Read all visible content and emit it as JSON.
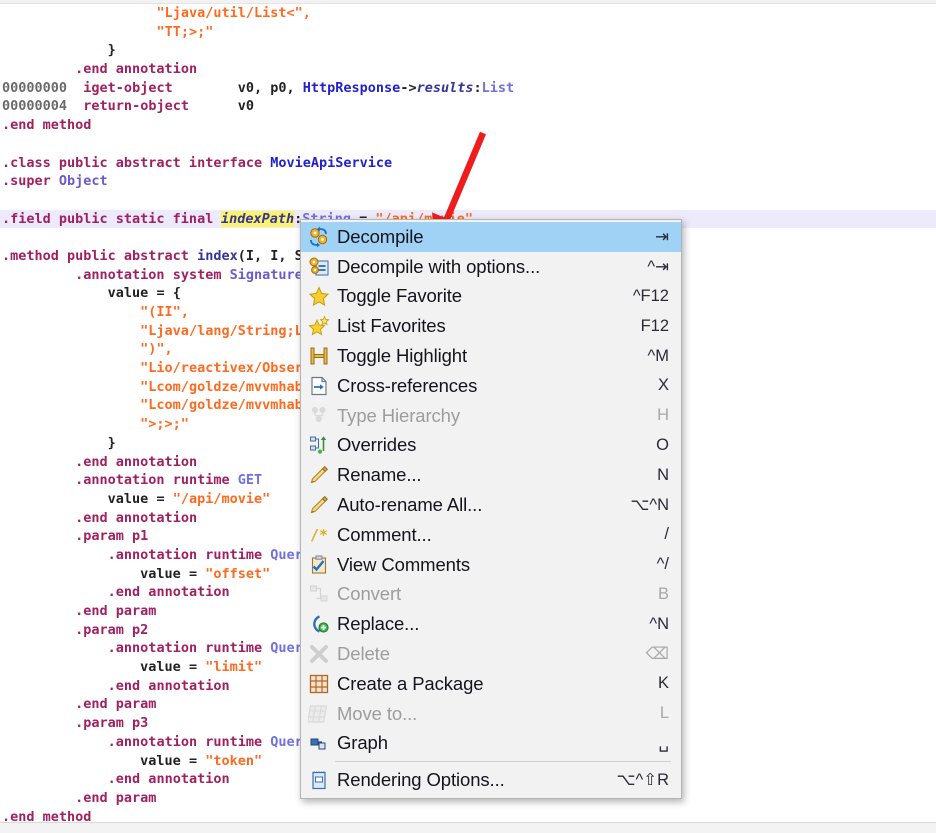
{
  "editor": {
    "name": "smali-code-view",
    "lines": [
      {
        "indent": 19,
        "tokens": [
          {
            "t": "\"Ljava/util/List<\",",
            "c": "t-str"
          }
        ]
      },
      {
        "indent": 19,
        "tokens": [
          {
            "t": "\"TT;>;\"",
            "c": "t-str"
          }
        ]
      },
      {
        "indent": 13,
        "tokens": [
          {
            "t": "}",
            "c": "t-plain"
          }
        ]
      },
      {
        "indent": 9,
        "tokens": [
          {
            "t": ".end annotation",
            "c": "t-dir"
          }
        ]
      },
      {
        "indent": 0,
        "tokens": [
          {
            "t": "00000000",
            "c": "t-num"
          },
          {
            "t": "  ",
            "c": "t-plain"
          },
          {
            "t": "iget-object",
            "c": "t-dir"
          },
          {
            "t": "        ",
            "c": "t-plain"
          },
          {
            "t": "v0, p0, ",
            "c": "t-plain"
          },
          {
            "t": "HttpResponse",
            "c": "t-blue"
          },
          {
            "t": "->",
            "c": "t-plain"
          },
          {
            "t": "results",
            "c": "t-field"
          },
          {
            "t": ":",
            "c": "t-plain"
          },
          {
            "t": "List",
            "c": "t-type"
          }
        ]
      },
      {
        "indent": 0,
        "tokens": [
          {
            "t": "00000004",
            "c": "t-num"
          },
          {
            "t": "  ",
            "c": "t-plain"
          },
          {
            "t": "return-object",
            "c": "t-dir"
          },
          {
            "t": "      ",
            "c": "t-plain"
          },
          {
            "t": "v0",
            "c": "t-plain"
          }
        ]
      },
      {
        "indent": 0,
        "tokens": [
          {
            "t": ".end method",
            "c": "t-dir"
          }
        ]
      },
      {
        "indent": 0,
        "tokens": []
      },
      {
        "indent": 0,
        "tokens": [
          {
            "t": ".class public abstract interface ",
            "c": "t-dir"
          },
          {
            "t": "MovieApiService",
            "c": "t-blue"
          }
        ]
      },
      {
        "indent": 0,
        "tokens": [
          {
            "t": ".super ",
            "c": "t-dir"
          },
          {
            "t": "Object",
            "c": "t-type2"
          }
        ]
      },
      {
        "indent": 0,
        "tokens": []
      },
      {
        "indent": 0,
        "highlight": true,
        "tokens": [
          {
            "t": ".field public static final ",
            "c": "t-dir"
          },
          {
            "t": "indexPath",
            "c": "t-field",
            "caret": true,
            "selected": true
          },
          {
            "t": ":",
            "c": "t-plain"
          },
          {
            "t": "String",
            "c": "t-type"
          },
          {
            "t": " = ",
            "c": "t-plain"
          },
          {
            "t": "\"/api/movie\"",
            "c": "t-str"
          }
        ]
      },
      {
        "indent": 0,
        "tokens": []
      },
      {
        "indent": 0,
        "tokens": [
          {
            "t": ".method public abstract ",
            "c": "t-dir"
          },
          {
            "t": "index",
            "c": "t-meth"
          },
          {
            "t": "(I, I, String, String)Observable",
            "c": "t-plain"
          }
        ]
      },
      {
        "indent": 9,
        "tokens": [
          {
            "t": ".annotation system ",
            "c": "t-dir"
          },
          {
            "t": "Signature",
            "c": "t-type2"
          }
        ]
      },
      {
        "indent": 13,
        "tokens": [
          {
            "t": "value = {",
            "c": "t-plain"
          }
        ]
      },
      {
        "indent": 17,
        "tokens": [
          {
            "t": "\"(II\",",
            "c": "t-str"
          }
        ]
      },
      {
        "indent": 17,
        "tokens": [
          {
            "t": "\"Ljava/lang/String;Ljava/lang/String;\",",
            "c": "t-str"
          }
        ]
      },
      {
        "indent": 17,
        "tokens": [
          {
            "t": "\")\",",
            "c": "t-str"
          }
        ]
      },
      {
        "indent": 17,
        "tokens": [
          {
            "t": "\"Lio/reactivex/Observable<\",",
            "c": "t-str"
          }
        ]
      },
      {
        "indent": 17,
        "tokens": [
          {
            "t": "\"Lcom/goldze/mvvmhabit/entity/HttpResponse<\",",
            "c": "t-str"
          }
        ]
      },
      {
        "indent": 17,
        "tokens": [
          {
            "t": "\"Lcom/goldze/mvvmhabit/entity/MovieEntity;\",",
            "c": "t-str"
          }
        ]
      },
      {
        "indent": 17,
        "tokens": [
          {
            "t": "\">;>;\"",
            "c": "t-str"
          }
        ]
      },
      {
        "indent": 13,
        "tokens": [
          {
            "t": "}",
            "c": "t-plain"
          }
        ]
      },
      {
        "indent": 9,
        "tokens": [
          {
            "t": ".end annotation",
            "c": "t-dir"
          }
        ]
      },
      {
        "indent": 9,
        "tokens": [
          {
            "t": ".annotation runtime ",
            "c": "t-dir"
          },
          {
            "t": "GET",
            "c": "t-type"
          }
        ]
      },
      {
        "indent": 13,
        "tokens": [
          {
            "t": "value = ",
            "c": "t-plain"
          },
          {
            "t": "\"/api/movie\"",
            "c": "t-str"
          }
        ]
      },
      {
        "indent": 9,
        "tokens": [
          {
            "t": ".end annotation",
            "c": "t-dir"
          }
        ]
      },
      {
        "indent": 9,
        "tokens": [
          {
            "t": ".param p1",
            "c": "t-dir"
          }
        ]
      },
      {
        "indent": 13,
        "tokens": [
          {
            "t": ".annotation runtime ",
            "c": "t-dir"
          },
          {
            "t": "Query",
            "c": "t-type"
          }
        ]
      },
      {
        "indent": 17,
        "tokens": [
          {
            "t": "value = ",
            "c": "t-plain"
          },
          {
            "t": "\"offset\"",
            "c": "t-str"
          }
        ]
      },
      {
        "indent": 13,
        "tokens": [
          {
            "t": ".end annotation",
            "c": "t-dir"
          }
        ]
      },
      {
        "indent": 9,
        "tokens": [
          {
            "t": ".end param",
            "c": "t-dir"
          }
        ]
      },
      {
        "indent": 9,
        "tokens": [
          {
            "t": ".param p2",
            "c": "t-dir"
          }
        ]
      },
      {
        "indent": 13,
        "tokens": [
          {
            "t": ".annotation runtime ",
            "c": "t-dir"
          },
          {
            "t": "Query",
            "c": "t-type"
          }
        ]
      },
      {
        "indent": 17,
        "tokens": [
          {
            "t": "value = ",
            "c": "t-plain"
          },
          {
            "t": "\"limit\"",
            "c": "t-str"
          }
        ]
      },
      {
        "indent": 13,
        "tokens": [
          {
            "t": ".end annotation",
            "c": "t-dir"
          }
        ]
      },
      {
        "indent": 9,
        "tokens": [
          {
            "t": ".end param",
            "c": "t-dir"
          }
        ]
      },
      {
        "indent": 9,
        "tokens": [
          {
            "t": ".param p3",
            "c": "t-dir"
          }
        ]
      },
      {
        "indent": 13,
        "tokens": [
          {
            "t": ".annotation runtime ",
            "c": "t-dir"
          },
          {
            "t": "Query",
            "c": "t-type"
          }
        ]
      },
      {
        "indent": 17,
        "tokens": [
          {
            "t": "value = ",
            "c": "t-plain"
          },
          {
            "t": "\"token\"",
            "c": "t-str"
          }
        ]
      },
      {
        "indent": 13,
        "tokens": [
          {
            "t": ".end annotation",
            "c": "t-dir"
          }
        ]
      },
      {
        "indent": 9,
        "tokens": [
          {
            "t": ".end param",
            "c": "t-dir"
          }
        ]
      },
      {
        "indent": 0,
        "tokens": [
          {
            "t": ".end method",
            "c": "t-dir"
          }
        ]
      }
    ]
  },
  "context_menu": {
    "name": "code-context-menu",
    "items": [
      {
        "label": "Decompile",
        "shortcut": "⇥",
        "icon": "decompile-icon",
        "enabled": true,
        "selected": true
      },
      {
        "label": "Decompile with options...",
        "shortcut": "^⇥",
        "icon": "decompile-options-icon",
        "enabled": true,
        "selected": false
      },
      {
        "label": "Toggle Favorite",
        "shortcut": "^F12",
        "icon": "star-icon",
        "enabled": true,
        "selected": false
      },
      {
        "label": "List Favorites",
        "shortcut": "F12",
        "icon": "star-list-icon",
        "enabled": true,
        "selected": false
      },
      {
        "label": "Toggle Highlight",
        "shortcut": "^M",
        "icon": "highlight-icon",
        "enabled": true,
        "selected": false
      },
      {
        "label": "Cross-references",
        "shortcut": "X",
        "icon": "cross-references-icon",
        "enabled": true,
        "selected": false
      },
      {
        "label": "Type Hierarchy",
        "shortcut": "H",
        "icon": "type-hierarchy-icon",
        "enabled": false,
        "selected": false
      },
      {
        "label": "Overrides",
        "shortcut": "O",
        "icon": "overrides-icon",
        "enabled": true,
        "selected": false
      },
      {
        "label": "Rename...",
        "shortcut": "N",
        "icon": "pencil-icon",
        "enabled": true,
        "selected": false
      },
      {
        "label": "Auto-rename All...",
        "shortcut": "⌥^N",
        "icon": "pencil-icon",
        "enabled": true,
        "selected": false
      },
      {
        "label": "Comment...",
        "shortcut": "/",
        "icon": "comment-icon",
        "enabled": true,
        "selected": false
      },
      {
        "label": "View Comments",
        "shortcut": "^/",
        "icon": "view-comments-icon",
        "enabled": true,
        "selected": false
      },
      {
        "label": "Convert",
        "shortcut": "B",
        "icon": "convert-icon",
        "enabled": false,
        "selected": false
      },
      {
        "label": "Replace...",
        "shortcut": "^N",
        "icon": "replace-icon",
        "enabled": true,
        "selected": false
      },
      {
        "label": "Delete",
        "shortcut": "⌫",
        "icon": "delete-icon",
        "enabled": false,
        "selected": false
      },
      {
        "label": "Create a Package",
        "shortcut": "K",
        "icon": "create-package-icon",
        "enabled": true,
        "selected": false
      },
      {
        "label": "Move to...",
        "shortcut": "L",
        "icon": "move-to-icon",
        "enabled": false,
        "selected": false
      },
      {
        "label": "Graph",
        "shortcut": "␣",
        "icon": "graph-icon",
        "enabled": true,
        "selected": false,
        "separator_after": true
      },
      {
        "label": "Rendering Options...",
        "shortcut": "⌥^⇧R",
        "icon": "rendering-options-icon",
        "enabled": true,
        "selected": false
      }
    ]
  },
  "annotation": {
    "name": "red-pointer-arrow",
    "color": "#ee1c1c",
    "points_to": "Decompile"
  },
  "colors": {
    "selection_blue": "#9fd2f5",
    "menu_background": "#f2f2f2",
    "line_highlight": "#eceafb",
    "text_selection_yellow": "#fbf36b",
    "string_orange": "#ff6a1e",
    "directive_magenta": "#a02060",
    "type_blue": "#7070e0"
  }
}
